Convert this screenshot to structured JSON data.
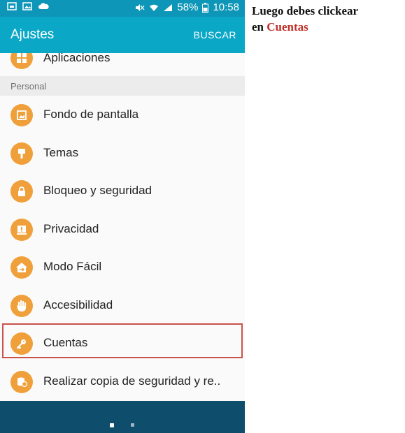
{
  "status_bar": {
    "battery": "58%",
    "time": "10:58"
  },
  "app_bar": {
    "title": "Ajustes",
    "action": "BUSCAR"
  },
  "list": {
    "top_item": "Aplicaciones",
    "section_header": "Personal",
    "items": [
      {
        "label": "Fondo de pantalla",
        "icon": "wallpaper-icon"
      },
      {
        "label": "Temas",
        "icon": "brush-icon"
      },
      {
        "label": "Bloqueo y seguridad",
        "icon": "lock-icon"
      },
      {
        "label": "Privacidad",
        "icon": "privacy-icon"
      },
      {
        "label": "Modo Fácil",
        "icon": "easy-mode-icon"
      },
      {
        "label": "Accesibilidad",
        "icon": "hand-icon"
      },
      {
        "label": "Cuentas",
        "icon": "key-icon"
      },
      {
        "label": "Realizar copia de seguridad y re..",
        "icon": "backup-icon"
      }
    ]
  },
  "annotation": {
    "line1": "Luego debes clickear",
    "line2_prefix": "en ",
    "line2_highlight": "Cuentas"
  },
  "colors": {
    "app_bar": "#0aa7c6",
    "status_bar": "#0d96b7",
    "icon_orange": "#f0a03a",
    "highlight_border": "#c9534a",
    "nav_bar": "#0e4e6c"
  }
}
